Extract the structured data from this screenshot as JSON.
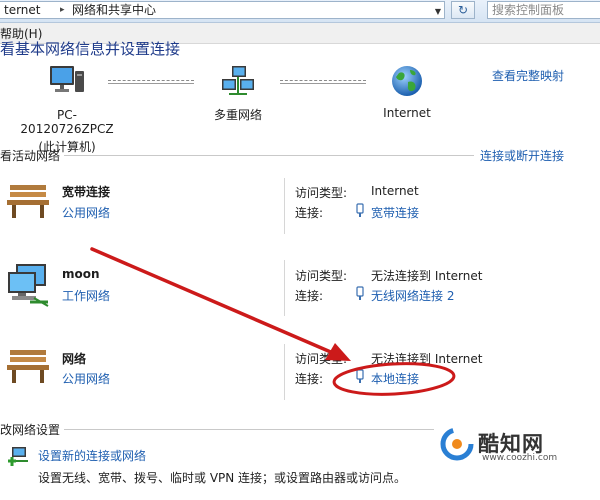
{
  "addressbar": {
    "crumb_1": "ternet",
    "crumb_separator": "▸",
    "crumb_2": "网络和共享中心",
    "dropdown_glyph": "▼",
    "refresh_glyph": "↻",
    "search_placeholder": "搜索控制面板"
  },
  "menubar": {
    "help": "帮助(H)"
  },
  "heading": "看基本网络信息并设置连接",
  "map": {
    "computer_name": "PC-20120726ZPCZ",
    "computer_sub": "(此计算机)",
    "middle_label": "多重网络",
    "internet_label": "Internet",
    "full_map_link": "查看完整映射"
  },
  "active": {
    "title": "看活动网络",
    "connect_link": "连接或断开连接",
    "access_type_label": "访问类型:",
    "connection_label": "连接:",
    "networks": [
      {
        "name": "宽带连接",
        "type": "公用网络",
        "icon": "park-bench-icon",
        "access": "Internet",
        "connection": "宽带连接"
      },
      {
        "name": "moon",
        "type": "工作网络",
        "icon": "work-computers-icon",
        "access": "无法连接到 Internet",
        "connection": "无线网络连接 2"
      },
      {
        "name": "网络",
        "type": "公用网络",
        "icon": "park-bench-icon",
        "access": "无法连接到 Internet",
        "connection": "本地连接"
      }
    ]
  },
  "change": {
    "title": "改网络设置",
    "setup_link": "设置新的连接或网络",
    "setup_desc": "设置无线、宽带、拨号、临时或 VPN 连接；或设置路由器或访问点。"
  },
  "watermark": {
    "name": "酷知网",
    "url": "www.coozhi.com"
  },
  "colors": {
    "link": "#1f5fb0",
    "annotation_red": "#cc1a1a",
    "heading_blue": "#1f3b8a"
  }
}
